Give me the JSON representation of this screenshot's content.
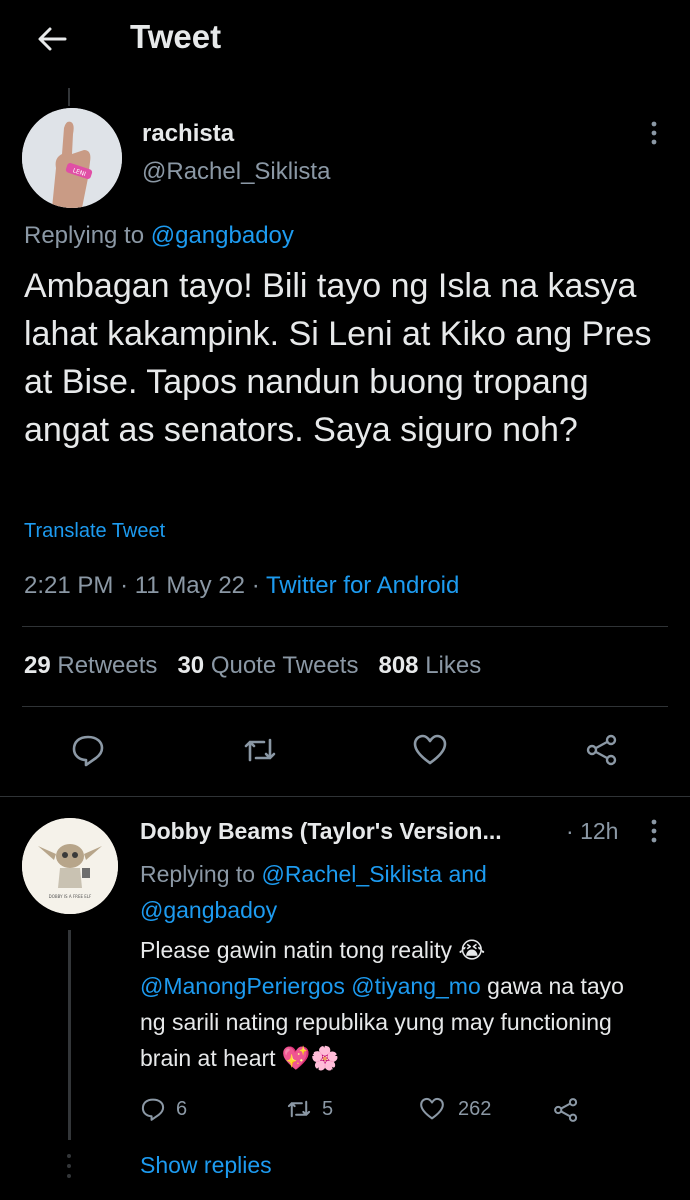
{
  "header": {
    "title": "Tweet",
    "back_icon": "arrow-left-icon"
  },
  "tweet": {
    "author_name": "rachista",
    "author_handle": "@Rachel_Siklista",
    "replying_prefix": "Replying to",
    "replying_to": "@gangbadoy",
    "text": "Ambagan tayo! Bili tayo ng Isla na kasya lahat kakampink. Si Leni at Kiko ang Pres at Bise. Tapos nandun buong tropang angat as senators. Saya siguro noh?",
    "translate_label": "Translate Tweet",
    "time": "2:21 PM",
    "date": "11 May 22",
    "source": "Twitter for Android",
    "separator": "·",
    "stats": {
      "retweets_count": "29",
      "retweets_label": "Retweets",
      "quotes_count": "30",
      "quotes_label": "Quote Tweets",
      "likes_count": "808",
      "likes_label": "Likes"
    },
    "wristband_text": "LENI"
  },
  "reply": {
    "author_name": "Dobby Beams (Taylor's Version...",
    "time_ago": "12h",
    "replying_prefix": "Replying to",
    "replying_to_1": "@Rachel_Siklista",
    "replying_joiner": "and",
    "replying_to_2": "@gangbadoy",
    "text_part1": "Please gawin natin tong reality",
    "emoji_crying": "😭",
    "mention_1": "@ManongPeriergos",
    "mention_2": "@tiyang_mo",
    "text_part2": "gawa na tayo ng sarili nating republika yung may functioning brain at heart",
    "emoji_heart": "💖",
    "emoji_flower": "🌸",
    "reply_count": "6",
    "retweet_count": "5",
    "like_count": "262",
    "show_replies_label": "Show replies",
    "avatar_caption": "DOBBY IS A FREE ELF"
  },
  "colors": {
    "background": "#000000",
    "text": "#e7e9ea",
    "muted": "#8b98a5",
    "accent": "#1d9bf0",
    "divider": "#2f3336"
  }
}
